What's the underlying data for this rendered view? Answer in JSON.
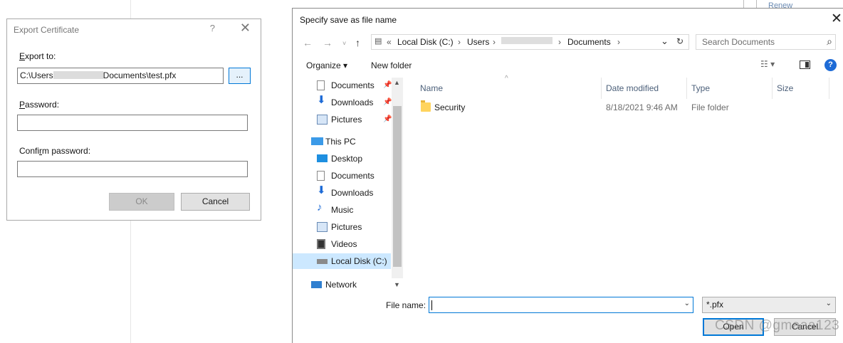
{
  "background": {
    "renew_link": "Renew"
  },
  "export_dialog": {
    "title": "Export Certificate",
    "help_glyph": "?",
    "close_glyph": "✕",
    "export_to_label_u": "E",
    "export_to_label_rest": "xport to:",
    "path_prefix": "C:\\Users",
    "path_suffix": "Documents\\test.pfx",
    "browse_label": "...",
    "password_label_u": "P",
    "password_label_rest": "assword:",
    "confirm_label_pre": "Confi",
    "confirm_label_u": "r",
    "confirm_label_rest": "m password:",
    "ok_label": "OK",
    "cancel_label": "Cancel"
  },
  "save_dialog": {
    "title": "Specify save as file name",
    "close_glyph": "✕",
    "address": {
      "overflow": "«",
      "segments": [
        "Local Disk (C:)",
        "Users",
        "Documents"
      ],
      "separator": "›"
    },
    "search_placeholder": "Search Documents",
    "toolbar": {
      "organize": "Organize ▾",
      "new_folder": "New folder"
    },
    "nav_items": [
      {
        "label": "Documents",
        "icon": "document-icon",
        "pinned": true
      },
      {
        "label": "Downloads",
        "icon": "download-icon",
        "pinned": true
      },
      {
        "label": "Pictures",
        "icon": "pictures-icon",
        "pinned": true
      },
      {
        "label": "This PC",
        "icon": "computer-icon",
        "pinned": false
      },
      {
        "label": "Desktop",
        "icon": "desktop-icon",
        "pinned": false
      },
      {
        "label": "Documents",
        "icon": "document-icon",
        "pinned": false
      },
      {
        "label": "Downloads",
        "icon": "download-icon",
        "pinned": false
      },
      {
        "label": "Music",
        "icon": "music-icon",
        "pinned": false
      },
      {
        "label": "Pictures",
        "icon": "pictures-icon",
        "pinned": false
      },
      {
        "label": "Videos",
        "icon": "videos-icon",
        "pinned": false
      },
      {
        "label": "Local Disk (C:)",
        "icon": "drive-icon",
        "pinned": false,
        "selected": true
      },
      {
        "label": "Network",
        "icon": "network-icon",
        "pinned": false
      }
    ],
    "columns": [
      "Name",
      "Date modified",
      "Type",
      "Size"
    ],
    "files": [
      {
        "name": "Security",
        "date_modified": "8/18/2021 9:46 AM",
        "type": "File folder",
        "size": ""
      }
    ],
    "file_name_label": "File name:",
    "file_name_value": "",
    "file_type": "*.pfx",
    "open_label": "Open",
    "cancel_label": "Cancel"
  },
  "watermark": "CSDN @gmaaa123",
  "colors": {
    "accent": "#0078d7",
    "selection": "#cce8ff",
    "folder": "#ffd45e"
  }
}
